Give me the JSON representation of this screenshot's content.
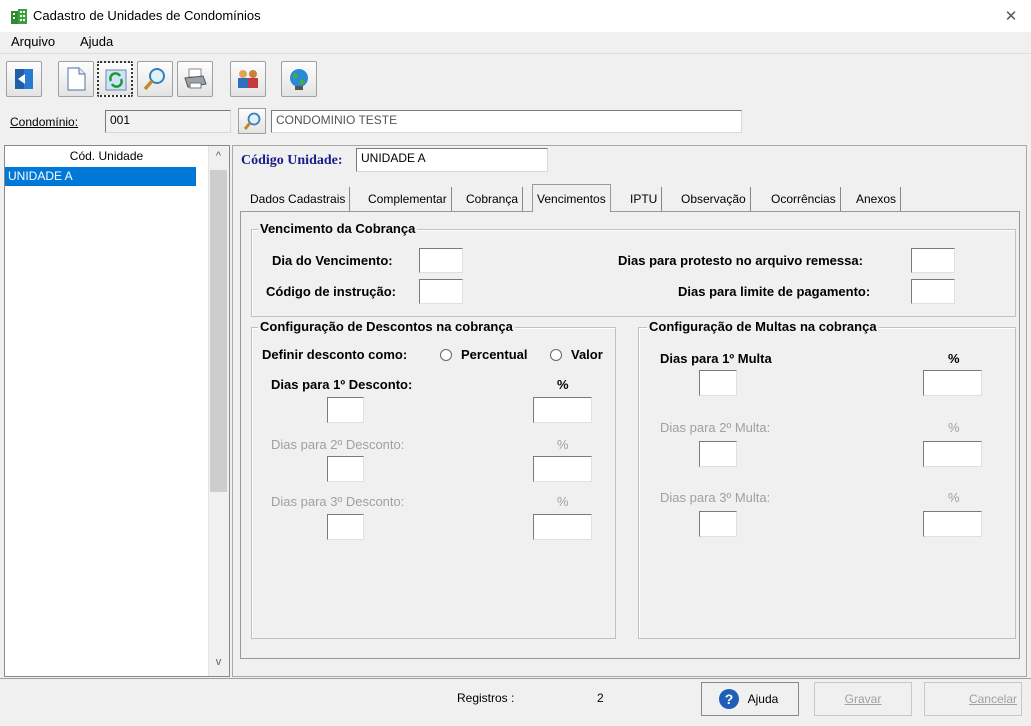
{
  "window": {
    "title": "Cadastro de Unidades de Condomínios",
    "close_glyph": "✕"
  },
  "menu": {
    "items": [
      "Arquivo",
      "Ajuda"
    ]
  },
  "toolbar": {
    "buttons": [
      "exit-icon",
      "new-document-icon",
      "refresh-icon",
      "search-icon",
      "print-icon",
      "users-icon",
      "globe-icon"
    ]
  },
  "condominio": {
    "label": "Condomínio:",
    "code": "001",
    "name": "CONDOMINIO TESTE"
  },
  "list": {
    "header": "Cód. Unidade",
    "items": [
      "UNIDADE A"
    ],
    "scroll_up": "^",
    "scroll_down": "v"
  },
  "codigo_unidade": {
    "label": "Código Unidade:",
    "value": "UNIDADE A"
  },
  "tabs": [
    "Dados Cadastrais",
    "Complementar",
    "Cobrança",
    "Vencimentos",
    "IPTU",
    "Observação",
    "Ocorrências",
    "Anexos"
  ],
  "active_tab": "Vencimentos",
  "vencimento": {
    "title": "Vencimento da  Cobrança",
    "dia_label": "Dia do Vencimento:",
    "codigo_label": "Código de instrução:",
    "protesto_label": "Dias para protesto no arquivo remessa:",
    "limite_label": "Dias para limite de pagamento:"
  },
  "descontos": {
    "title": "Configuração de Descontos na cobrança",
    "definir_label": "Definir desconto como:",
    "opt_percentual": "Percentual",
    "opt_valor": "Valor",
    "d1_label": "Dias para 1º Desconto:",
    "d2_label": "Dias para 2º Desconto:",
    "d3_label": "Dias para 3º Desconto:",
    "pct": "%"
  },
  "multas": {
    "title": "Configuração de Multas na cobrança",
    "m1_label": "Dias para 1º Multa",
    "m2_label": "Dias para 2º Multa:",
    "m3_label": "Dias para 3º Multa:",
    "pct": "%"
  },
  "footer": {
    "registros_label": "Registros :",
    "registros_value": "2",
    "ajuda": "Ajuda",
    "gravar": "Gravar",
    "cancelar": "Cancelar"
  },
  "colors": {
    "selection": "#0078d7",
    "label_blue": "#1a1a8a",
    "disabled": "#a0a0a0"
  }
}
